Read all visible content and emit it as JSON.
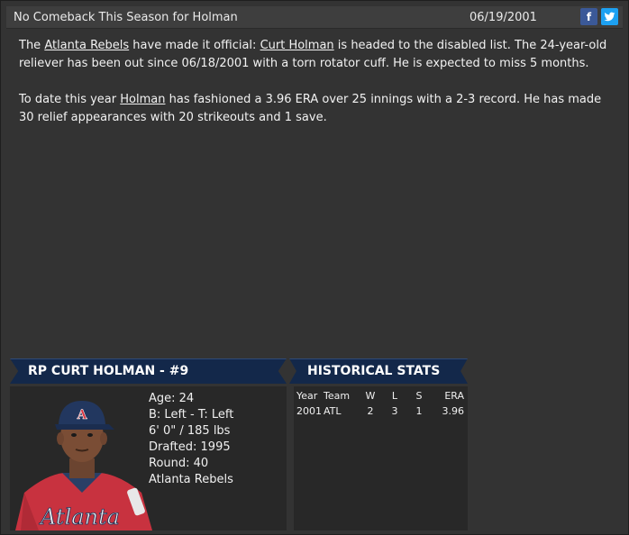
{
  "header": {
    "title": "No Comeback This Season for Holman",
    "date": "06/19/2001",
    "facebook_glyph": "f",
    "facebook_icon": "facebook-icon",
    "twitter_icon": "twitter-icon"
  },
  "article": {
    "p1": {
      "t1": "The ",
      "team_link": "Atlanta Rebels",
      "t2": " have made it official: ",
      "player_link": "Curt Holman",
      "t3": " is headed to the disabled list. The 24-year-old reliever has been out since 06/18/2001 with a torn rotator cuff. He is expected to miss 5 months."
    },
    "p2": {
      "t1": "To date this year ",
      "player_link": "Holman",
      "t2": " has fashioned a 3.96 ERA over 25 innings with a 2-3 record. He has made 30 relief appearances with 20 strikeouts and 1 save."
    }
  },
  "player_panel": {
    "title": "RP CURT HOLMAN - #9",
    "age": "Age: 24",
    "bats_throws": "B: Left - T: Left",
    "height_weight": "6' 0\" / 185 lbs",
    "drafted": "Drafted: 1995",
    "round": "Round: 40",
    "team": "Atlanta Rebels",
    "jersey_text": "Atlanta",
    "cap_letter": "A"
  },
  "stats_panel": {
    "title": "HISTORICAL STATS",
    "columns": [
      "Year",
      "Team",
      "W",
      "L",
      "S",
      "ERA"
    ],
    "rows": [
      [
        "2001",
        "ATL",
        "2",
        "3",
        "1",
        "3.96"
      ]
    ]
  },
  "colors": {
    "ribbon": "#13284a",
    "background": "#333333",
    "panel": "#282828",
    "facebook": "#3b5998",
    "twitter": "#1da1f2"
  }
}
